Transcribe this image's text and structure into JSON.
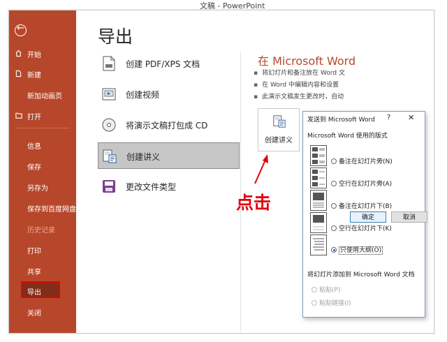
{
  "window": {
    "title_partial": "文稿 - PowerPoint"
  },
  "sidebar": {
    "items": [
      {
        "label": "开始",
        "icon": "home-icon"
      },
      {
        "label": "新建",
        "icon": "new-doc-icon"
      },
      {
        "label": "新加动画页",
        "icon": ""
      },
      {
        "label": "打开",
        "icon": "folder-open-icon"
      },
      {
        "label": "信息"
      },
      {
        "label": "保存"
      },
      {
        "label": "另存为"
      },
      {
        "label": "保存到百度网盘"
      },
      {
        "label": "历史记录",
        "disabled": true
      },
      {
        "label": "打印"
      },
      {
        "label": "共享"
      },
      {
        "label": "导出",
        "selected": true
      },
      {
        "label": "关闭"
      }
    ]
  },
  "main": {
    "title": "导出",
    "options": [
      {
        "label": "创建 PDF/XPS 文档",
        "icon": "pdf-document-icon"
      },
      {
        "label": "创建视频",
        "icon": "video-icon"
      },
      {
        "label": "将演示文稿打包成 CD",
        "icon": "cd-disc-icon"
      },
      {
        "label": "创建讲义",
        "icon": "handout-icon",
        "selected": true
      },
      {
        "label": "更改文件类型",
        "icon": "file-type-icon"
      }
    ]
  },
  "right": {
    "title": "在 Microsoft Word",
    "bullets": [
      "将幻灯片和备注放在 Word 文",
      "在 Word 中编辑内容和设置",
      "此演示文稿发生更改时，自动"
    ],
    "button_label": "创建讲义"
  },
  "annotation": {
    "label": "点击",
    "color": "#e2000f"
  },
  "dialog": {
    "title": "发送到 Microsoft Word",
    "help": "?",
    "close": "✕",
    "layout_section": "Microsoft Word 使用的版式",
    "layouts": [
      {
        "label": "备注在幻灯片旁(N)",
        "checked": false
      },
      {
        "label": "空行在幻灯片旁(A)",
        "checked": false
      },
      {
        "label": "备注在幻灯片下(B)",
        "checked": false
      },
      {
        "label": "空行在幻灯片下(K)",
        "checked": false
      },
      {
        "label": "只使用大纲(O)",
        "checked": true
      }
    ],
    "add_section": "将幻灯片添加到 Microsoft Word 文档",
    "add_options": [
      {
        "label": "粘贴(P)",
        "disabled": true
      },
      {
        "label": "粘贴链接(I)",
        "disabled": true
      }
    ],
    "ok_label": "确定",
    "cancel_label": "取消"
  },
  "colors": {
    "sidebar": "#b7472a",
    "accent": "#b7472a",
    "highlight": "#e2000f"
  }
}
